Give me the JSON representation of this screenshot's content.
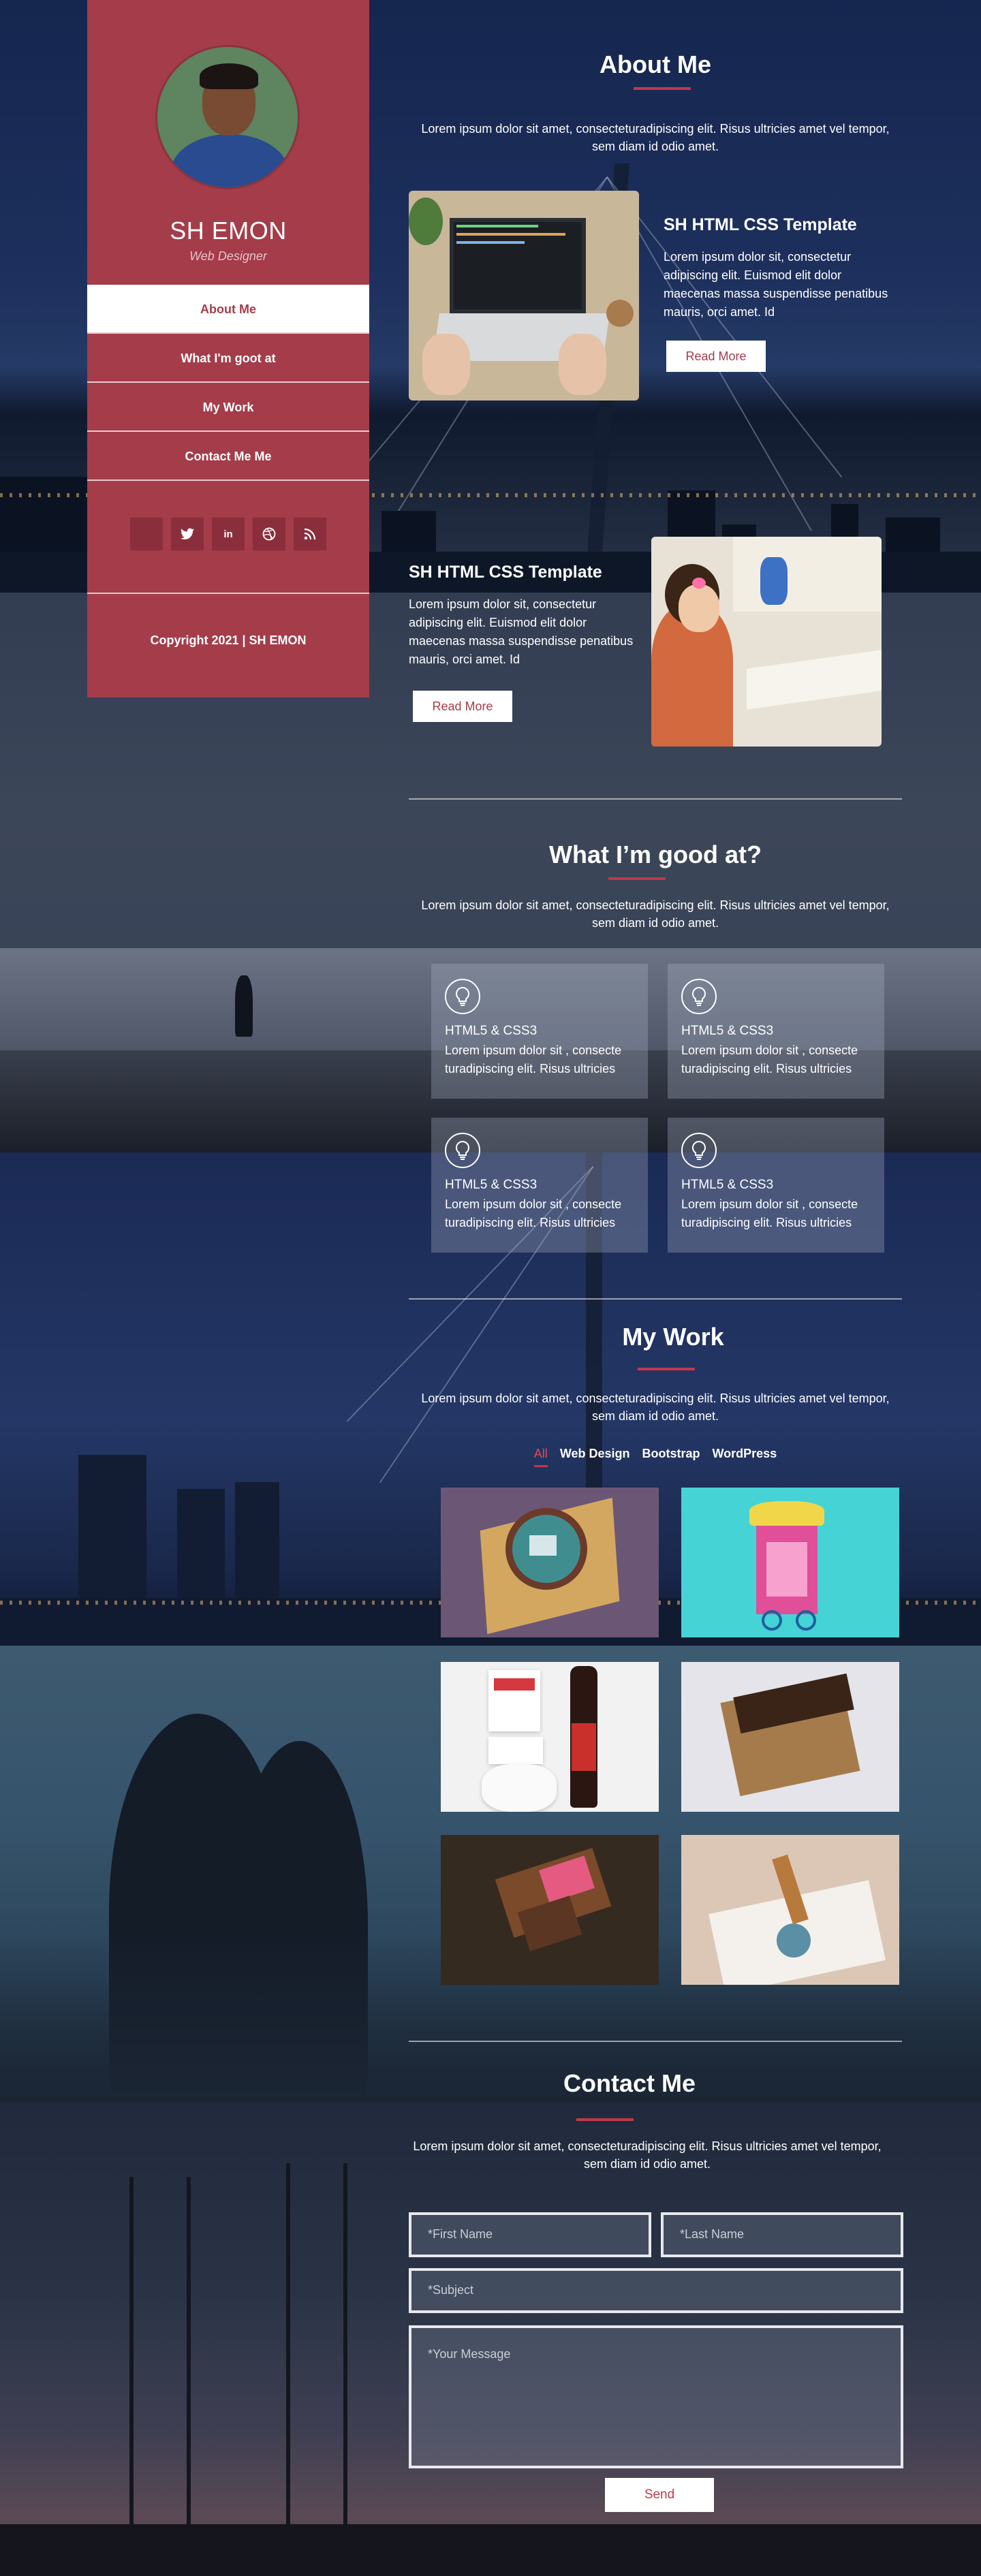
{
  "sidebar": {
    "name": "SH EMON",
    "role": "Web Designer",
    "nav": [
      {
        "label": "About Me"
      },
      {
        "label": "What I'm goot at"
      },
      {
        "label": "My Work"
      },
      {
        "label": "Contact Me Me"
      }
    ],
    "social_icons": [
      "facebook-icon",
      "twitter-icon",
      "linkedin-icon",
      "dribbble-icon",
      "rss-icon"
    ],
    "copyright": "Copyright 2021 | SH EMON"
  },
  "about": {
    "title": "About Me",
    "lead": "Lorem ipsum dolor sit amet, consecteturadipiscing elit. Risus ultricies amet vel tempor, sem diam id odio amet.",
    "cards": [
      {
        "title": "SH HTML CSS Template",
        "text": "Lorem ipsum dolor sit, consectetur adipiscing elit. Euismod elit dolor maecenas massa suspendisse penatibus mauris, orci amet. Id",
        "button": "Read More"
      },
      {
        "title": "SH HTML CSS Template",
        "text": "Lorem ipsum dolor sit, consectetur adipiscing elit. Euismod elit dolor maecenas massa suspendisse penatibus mauris, orci amet. Id",
        "button": "Read More"
      }
    ]
  },
  "skills": {
    "title": "What I’m good at?",
    "lead": "Lorem ipsum dolor sit amet, consecteturadipiscing elit. Risus ultricies amet vel tempor, sem diam id odio amet.",
    "items": [
      {
        "title": "HTML5 & CSS3",
        "text": "Lorem ipsum dolor sit , consecte turadipiscing elit. Risus ultricies"
      },
      {
        "title": "HTML5 & CSS3",
        "text": "Lorem ipsum dolor sit , consecte turadipiscing elit. Risus ultricies"
      },
      {
        "title": "HTML5 & CSS3",
        "text": "Lorem ipsum dolor sit , consecte turadipiscing elit. Risus ultricies"
      },
      {
        "title": "HTML5 & CSS3",
        "text": "Lorem ipsum dolor sit , consecte turadipiscing elit. Risus ultricies"
      }
    ]
  },
  "work": {
    "title": "My Work",
    "lead": "Lorem ipsum dolor sit amet, consecteturadipiscing elit. Risus ultricies amet vel tempor, sem diam id odio amet.",
    "filters": [
      "All",
      "Web Design",
      "Bootstrap",
      "WordPress"
    ],
    "active_filter": "All",
    "items": [
      {
        "name": "cake-box-mockup",
        "bg": "#6b5775"
      },
      {
        "name": "ice-cream-cart-mockup",
        "bg": "#45d3d6"
      },
      {
        "name": "stationery-bottle-mockup",
        "bg": "#f2f2f2"
      },
      {
        "name": "cardboard-box-mockup",
        "bg": "#e4e4ea"
      },
      {
        "name": "chocolate-bar-mockup",
        "bg": "#352a20"
      },
      {
        "name": "wax-seal-envelope-mockup",
        "bg": "#dcc7b7"
      }
    ]
  },
  "contact": {
    "title": "Contact Me",
    "lead": "Lorem ipsum dolor sit amet, consecteturadipiscing elit. Risus ultricies amet vel tempor, sem diam id odio amet.",
    "first_name_placeholder": "*First Name",
    "last_name_placeholder": "*Last Name",
    "subject_placeholder": "*Subject",
    "message_placeholder": "*Your Message",
    "send_label": "Send"
  },
  "colors": {
    "accent": "#a43c4a",
    "accent_line": "#c0394a"
  }
}
